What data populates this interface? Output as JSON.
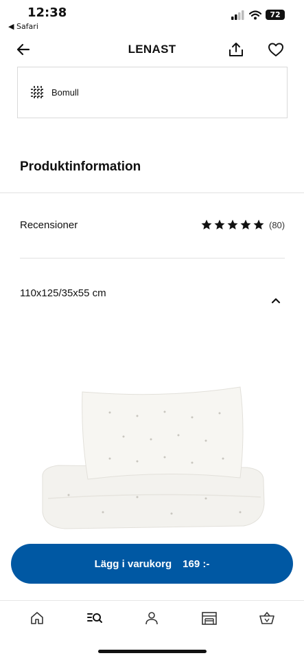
{
  "status_bar": {
    "time": "12:38",
    "back_app": "◀ Safari",
    "battery": "72"
  },
  "nav": {
    "title": "LENAST",
    "icons": [
      "arrow-left-icon",
      "share-icon",
      "heart-icon"
    ]
  },
  "material": {
    "label": "Bomull",
    "icon": "fabric-icon"
  },
  "product_info": {
    "title": "Produktinformation"
  },
  "reviews": {
    "label": "Recensioner",
    "rating": 4.5,
    "max_rating": 5,
    "count": "(80)"
  },
  "size": {
    "label": "110x125/35x55 cm",
    "expanded": true
  },
  "cart_button": {
    "label": "Lägg i varukorg",
    "price": "169 :-",
    "color": "#0058a3"
  },
  "tab_bar": {
    "items": [
      "home-icon",
      "search-icon",
      "profile-icon",
      "store-icon",
      "cart-icon"
    ]
  }
}
